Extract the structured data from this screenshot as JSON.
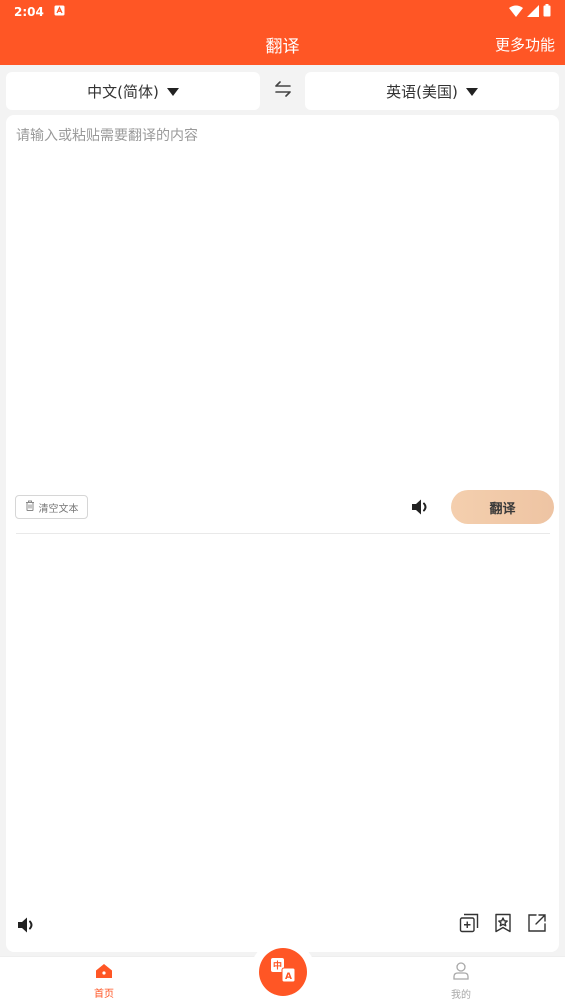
{
  "status_bar": {
    "time": "2:04"
  },
  "app_bar": {
    "title": "翻译",
    "more_label": "更多功能"
  },
  "languages": {
    "source": "中文(简体)",
    "target": "英语(美国)"
  },
  "input": {
    "placeholder": "请输入或粘贴需要翻译的内容",
    "value": ""
  },
  "actions": {
    "clear_label": "清空文本",
    "translate_label": "翻译"
  },
  "bottom_nav": {
    "home_label": "首页",
    "center_icon": "translate-icon",
    "mine_label": "我的"
  },
  "colors": {
    "accent": "#ff5625",
    "translate_button": "#f2cba9",
    "nav_inactive": "#a8a8a8"
  }
}
